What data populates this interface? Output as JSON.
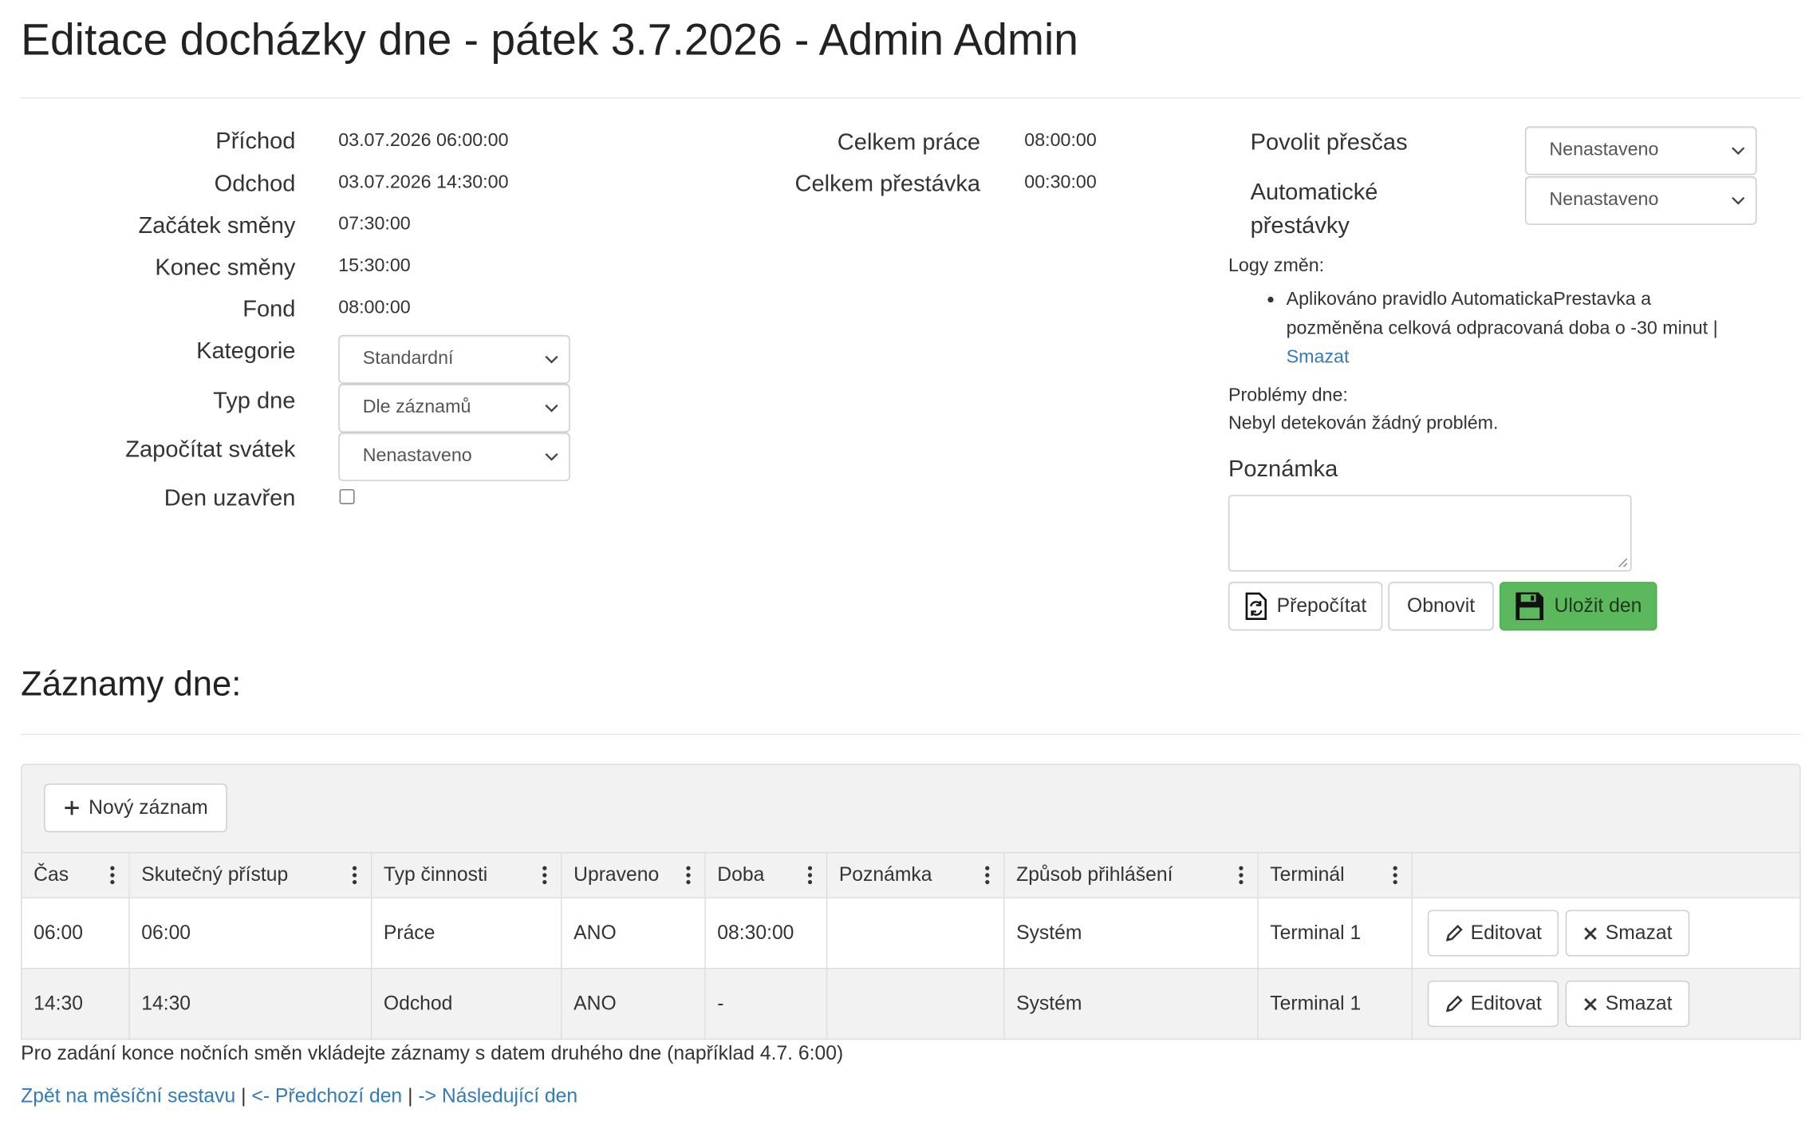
{
  "page_title": "Editace docházky dne - pátek 3.7.2026 - Admin Admin",
  "left_fields": [
    {
      "label": "Příchod",
      "value": "03.07.2026 06:00:00"
    },
    {
      "label": "Odchod",
      "value": "03.07.2026 14:30:00"
    },
    {
      "label": "Začátek směny",
      "value": "07:30:00"
    },
    {
      "label": "Konec směny",
      "value": "15:30:00"
    },
    {
      "label": "Fond",
      "value": "08:00:00"
    }
  ],
  "kategorie": {
    "label": "Kategorie",
    "value": "Standardní"
  },
  "typ_dne": {
    "label": "Typ dne",
    "value": "Dle záznamů"
  },
  "zapocitat_svatek": {
    "label": "Započítat svátek",
    "value": "Nenastaveno"
  },
  "den_uzavren": {
    "label": "Den uzavřen",
    "checked": false
  },
  "totals": [
    {
      "label": "Celkem práce",
      "value": "08:00:00"
    },
    {
      "label": "Celkem přestávka",
      "value": "00:30:00"
    }
  ],
  "povolit_prescas": {
    "label": "Povolit přesčas",
    "value": "Nenastaveno"
  },
  "automaticke_prestavky": {
    "label_line1": "Automatické",
    "label_line2": "přestávky",
    "value": "Nenastaveno"
  },
  "logs": {
    "heading": "Logy změn:",
    "items": [
      {
        "line1": "Aplikováno pravidlo AutomatickaPrestavka a",
        "line2": "pozměněna celková odpracovaná doba o -30 minut |",
        "link": "Smazat"
      }
    ]
  },
  "problems": {
    "heading": "Problémy dne:",
    "text": "Nebyl detekován žádný problém."
  },
  "poznamka": {
    "label": "Poznámka",
    "value": ""
  },
  "actions": {
    "recalc": "Přepočítat",
    "refresh": "Obnovit",
    "save": "Uložit den"
  },
  "records": {
    "heading": "Záznamy dne:",
    "new_button": "Nový záznam",
    "columns": [
      "Čas",
      "Skutečný přístup",
      "Typ činnosti",
      "Upraveno",
      "Doba",
      "Poznámka",
      "Způsob přihlášení",
      "Terminál"
    ],
    "rows": [
      {
        "cas": "06:00",
        "pristup": "06:00",
        "typ": "Práce",
        "upraveno": "ANO",
        "doba": "08:30:00",
        "poznamka": "",
        "zpusob": "Systém",
        "terminal": "Terminal 1"
      },
      {
        "cas": "14:30",
        "pristup": "14:30",
        "typ": "Odchod",
        "upraveno": "ANO",
        "doba": "-",
        "poznamka": "",
        "zpusob": "Systém",
        "terminal": "Terminal 1"
      }
    ],
    "edit_label": "Editovat",
    "delete_label": "Smazat"
  },
  "footer": {
    "note": "Pro zadání konce nočních směn vkládejte záznamy s datem druhého dne (například 4.7. 6:00)",
    "back_link": "Zpět na měsíční sestavu",
    "separator": "|",
    "prev_link": "<- Předchozí den",
    "next_link": "-> Následující den"
  },
  "colors": {
    "link": "#337ab7",
    "save_bg": "#5cb85c",
    "panel_bg": "#f2f2f2",
    "border": "#dddddd"
  }
}
